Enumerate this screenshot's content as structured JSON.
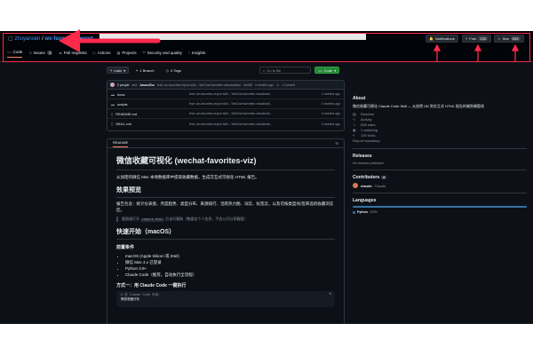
{
  "repo": {
    "owner": "zhuyansen",
    "name": "wx-favorites-report",
    "separator": "/"
  },
  "header_buttons": {
    "notifications": "Notifications",
    "fork_label": "Fork",
    "fork_count": "130",
    "star_label": "Star",
    "star_count": "835"
  },
  "tabs": [
    {
      "label": "Code",
      "icon": "code-icon"
    },
    {
      "label": "Issues",
      "count": "1",
      "icon": "issue-icon"
    },
    {
      "label": "Pull requests",
      "icon": "pr-icon"
    },
    {
      "label": "Actions",
      "icon": "play-icon"
    },
    {
      "label": "Projects",
      "icon": "table-icon"
    },
    {
      "label": "Security and quality",
      "icon": "shield-icon"
    },
    {
      "label": "Insights",
      "icon": "graph-icon"
    }
  ],
  "toolbar": {
    "branch": "main",
    "branches": "1 Branch",
    "tags": "0 Tags",
    "goto_placeholder": "Go to file",
    "code_button": "Code"
  },
  "commit_bar": {
    "authors": "2 people",
    "and": "and",
    "author": "JasonZhu",
    "message": "feat: wx-favorites-report skill – WeChat favorites visualization",
    "hash": "f2e6f8",
    "time": "4 months ago",
    "commits": "1 Commit"
  },
  "files": [
    {
      "name": "docs",
      "type": "folder",
      "message": "feat: wx-favorites-report skill – WeChat favorites visualizati...",
      "time": "4 months ago"
    },
    {
      "name": "scripts",
      "type": "folder",
      "message": "feat: wx-favorites-report skill – WeChat favorites visualizati...",
      "time": "4 months ago"
    },
    {
      "name": "README.md",
      "type": "file",
      "message": "feat: wx-favorites-report skill – WeChat favorites visualizati...",
      "time": "4 months ago"
    },
    {
      "name": "SKILL.md",
      "type": "file",
      "message": "feat: wx-favorites-report skill – WeChat favorites visualizati...",
      "time": "4 months ago"
    }
  ],
  "readme": {
    "tab": "README",
    "title": "微信收藏可视化 (wechat-favorites-viz)",
    "intro": "从加密的微信 Mac 本地数据库中提取收藏数据，生成交互式可视化 HTML 报告。",
    "h_preview": "效果预览",
    "preview_text": "报告包含：统计仪表盘、月度趋势、类型分布、来源排行、活跃热力图、词云、标签云，以及可按类型/标签筛选的收藏浏览区。",
    "quote_prefix": "截图请打开",
    "quote_code": "report.html",
    "quote_suffix": "后自行截取（数据含个人信息，不宜公开分享截图）",
    "h_quickstart": "快速开始（macOS）",
    "h_prereq": "前置条件",
    "prereqs": [
      "macOS (Apple Silicon 或 Intel)",
      "微信 Mac 4.x 已登录",
      "Python 3.9+",
      "Claude Code（推荐，自动执行全流程）"
    ],
    "h_method1": "方式一：用 Claude Code 一键执行",
    "code_line1": "# 在 Claude Code 中说：",
    "code_line2": "微信收藏分析"
  },
  "about": {
    "heading": "About",
    "description": "微信收藏可视化 Claude Code Skill — 从加密 DB 到交互式 HTML 报告的端到端管线",
    "readme": "Readme",
    "activity": "Activity",
    "stars": "835 stars",
    "watching": "1 watching",
    "forks": "130 forks",
    "report": "Report repository"
  },
  "releases": {
    "heading": "Releases",
    "text": "No releases published"
  },
  "contributors": {
    "heading": "Contributors",
    "count": "2",
    "name": "claude",
    "display": "Claude"
  },
  "languages": {
    "heading": "Languages",
    "name": "Python",
    "percent": "100%",
    "color": "#3572A5"
  },
  "colors": {
    "annotation": "#ff2a4a",
    "accent": "#238636",
    "link": "#4493f8"
  }
}
